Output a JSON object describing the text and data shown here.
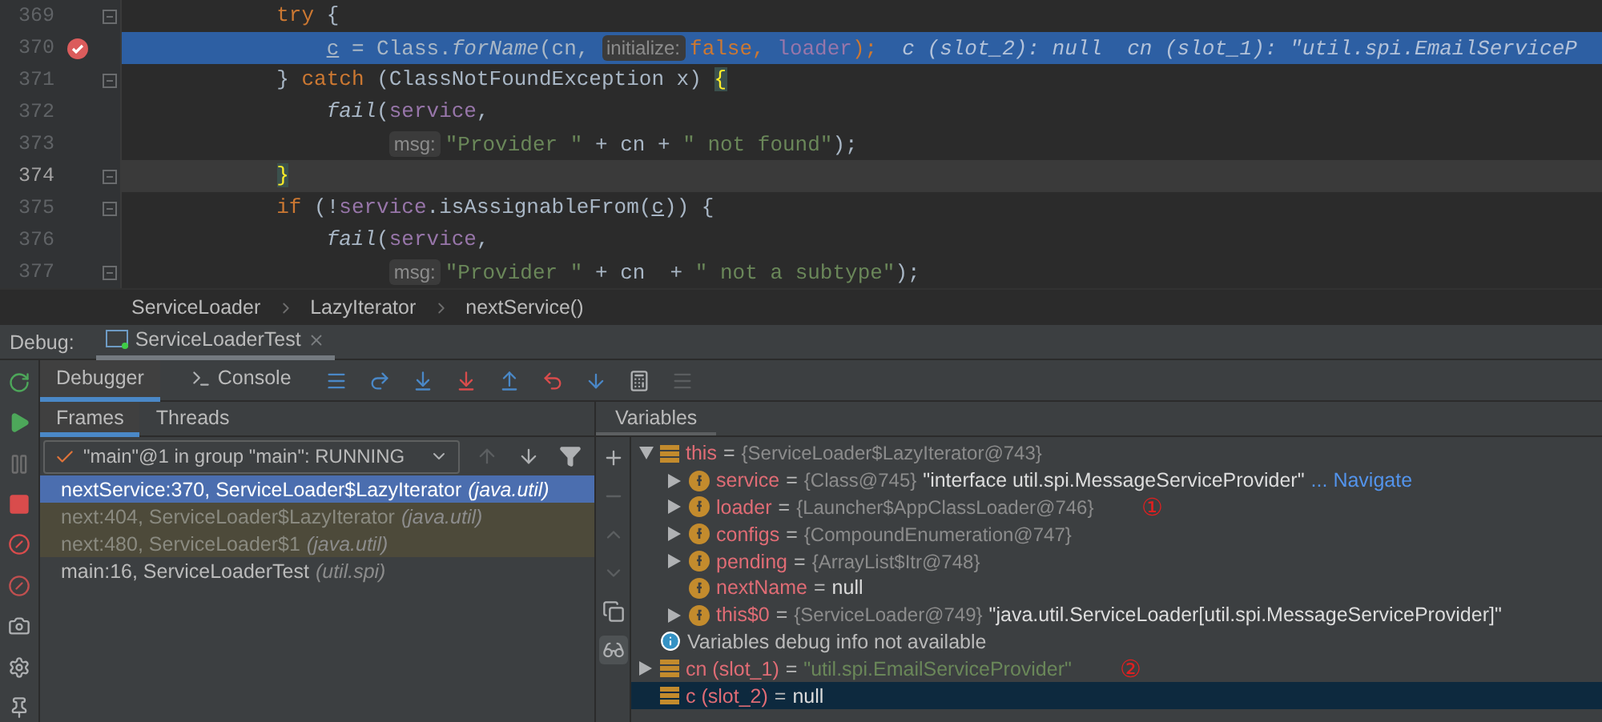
{
  "editor": {
    "lines": [
      {
        "number": "369",
        "execution": false,
        "caret": false,
        "breakpoint": false,
        "fold": true,
        "tokens": [
          {
            "kind": "keyword",
            "text": "            try"
          },
          {
            "kind": "plain",
            "text": " {"
          }
        ]
      },
      {
        "number": "370",
        "execution": true,
        "caret": false,
        "breakpoint": true,
        "fold": false,
        "tokens": [
          {
            "kind": "var",
            "text": "                c"
          },
          {
            "kind": "plain",
            "text": " = Class."
          },
          {
            "kind": "method",
            "text": "forName"
          },
          {
            "kind": "plain",
            "text": "(cn, "
          },
          {
            "kind": "hint",
            "text": "initialize:"
          },
          {
            "kind": "keyword",
            "text": "false, "
          },
          {
            "kind": "field",
            "text": "loader"
          },
          {
            "kind": "keyword",
            "text": ");"
          },
          {
            "kind": "inline",
            "text": "  c (slot_2): null  cn (slot_1): \"util.spi.EmailServiceP"
          }
        ]
      },
      {
        "number": "371",
        "execution": false,
        "caret": false,
        "breakpoint": false,
        "fold": true,
        "tokens": [
          {
            "kind": "plain",
            "text": "            } "
          },
          {
            "kind": "keyword",
            "text": "catch"
          },
          {
            "kind": "plain",
            "text": " (ClassNotFoundException x) "
          },
          {
            "kind": "brace",
            "text": "{"
          }
        ]
      },
      {
        "number": "372",
        "execution": false,
        "caret": false,
        "breakpoint": false,
        "fold": false,
        "tokens": [
          {
            "kind": "method",
            "text": "                fail"
          },
          {
            "kind": "plain",
            "text": "("
          },
          {
            "kind": "field",
            "text": "service"
          },
          {
            "kind": "plain",
            "text": ","
          }
        ]
      },
      {
        "number": "373",
        "execution": false,
        "caret": false,
        "breakpoint": false,
        "fold": false,
        "tokens": [
          {
            "kind": "hint",
            "text": "                     msg:"
          },
          {
            "kind": "string",
            "text": "\"Provider \""
          },
          {
            "kind": "plain",
            "text": " + cn + "
          },
          {
            "kind": "string",
            "text": "\" not found\""
          },
          {
            "kind": "plain",
            "text": ");"
          }
        ]
      },
      {
        "number": "374",
        "execution": false,
        "caret": true,
        "breakpoint": false,
        "fold": true,
        "tokens": [
          {
            "kind": "brace",
            "text": "            }"
          }
        ]
      },
      {
        "number": "375",
        "execution": false,
        "caret": false,
        "breakpoint": false,
        "fold": true,
        "tokens": [
          {
            "kind": "keyword",
            "text": "            if"
          },
          {
            "kind": "plain",
            "text": " (!"
          },
          {
            "kind": "field",
            "text": "service"
          },
          {
            "kind": "plain",
            "text": ".isAssignableFrom("
          },
          {
            "kind": "var",
            "text": "c"
          },
          {
            "kind": "plain",
            "text": ")) {"
          }
        ]
      },
      {
        "number": "376",
        "execution": false,
        "caret": false,
        "breakpoint": false,
        "fold": false,
        "tokens": [
          {
            "kind": "method",
            "text": "                fail"
          },
          {
            "kind": "plain",
            "text": "("
          },
          {
            "kind": "field",
            "text": "service"
          },
          {
            "kind": "plain",
            "text": ","
          }
        ]
      },
      {
        "number": "377",
        "execution": false,
        "caret": false,
        "breakpoint": false,
        "fold": true,
        "tokens": [
          {
            "kind": "hint",
            "text": "                     msg:"
          },
          {
            "kind": "string",
            "text": "\"Provider \""
          },
          {
            "kind": "plain",
            "text": " + cn  + "
          },
          {
            "kind": "string",
            "text": "\" not a subtype\""
          },
          {
            "kind": "plain",
            "text": ");"
          }
        ]
      }
    ]
  },
  "breadcrumbs": [
    "ServiceLoader",
    "LazyIterator",
    "nextService()"
  ],
  "debug_bar": {
    "label": "Debug:",
    "session": "ServiceLoaderTest"
  },
  "tabs": [
    {
      "label": "Debugger",
      "selected": true
    },
    {
      "label": "Console",
      "selected": false
    }
  ],
  "frames_panel": {
    "tabs": [
      {
        "label": "Frames",
        "selected": true
      },
      {
        "label": "Threads",
        "selected": false
      }
    ],
    "thread": {
      "value": "\"main\"@1 in group \"main\": RUNNING"
    },
    "frames": [
      {
        "frame": "nextService:370, ServiceLoader$LazyIterator",
        "package": "(java.util)",
        "kind": "project",
        "selected": true
      },
      {
        "frame": "next:404, ServiceLoader$LazyIterator",
        "package": "(java.util)",
        "kind": "library",
        "selected": false
      },
      {
        "frame": "next:480, ServiceLoader$1",
        "package": "(java.util)",
        "kind": "library",
        "selected": false
      },
      {
        "frame": "main:16, ServiceLoaderTest",
        "package": "(util.spi)",
        "kind": "project",
        "selected": false
      }
    ]
  },
  "variables": {
    "title": "Variables",
    "items": [
      {
        "kind": "object",
        "expandable": true,
        "expanded": true,
        "name": "this",
        "sep": "=",
        "ref": "{ServiceLoader$LazyIterator@743}",
        "selected": false,
        "children": [
          {
            "kind": "field",
            "expandable": true,
            "expanded": false,
            "name": "service",
            "sep": "=",
            "ref": "{Class@745}",
            "value": "\"interface util.spi.MessageServiceProvider\"",
            "is_string": false,
            "link": "... Navigate",
            "selected": false
          },
          {
            "kind": "field",
            "expandable": true,
            "expanded": false,
            "name": "loader",
            "sep": "=",
            "ref": "{Launcher$AppClassLoader@746}",
            "callout": "①",
            "selected": false
          },
          {
            "kind": "field",
            "expandable": true,
            "expanded": false,
            "name": "configs",
            "sep": "=",
            "ref": "{CompoundEnumeration@747}",
            "selected": false
          },
          {
            "kind": "field",
            "expandable": true,
            "expanded": false,
            "name": "pending",
            "sep": "=",
            "ref": "{ArrayList$Itr@748}",
            "selected": false
          },
          {
            "kind": "field",
            "expandable": false,
            "expanded": false,
            "name": "nextName",
            "sep": "=",
            "value": "null",
            "is_string": false,
            "selected": false
          },
          {
            "kind": "field",
            "expandable": true,
            "expanded": false,
            "name": "this$0",
            "sep": "=",
            "ref": "{ServiceLoader@749}",
            "value": "\"java.util.ServiceLoader[util.spi.MessageServiceProvider]\"",
            "is_string": false,
            "selected": false
          }
        ]
      },
      {
        "kind": "info",
        "expandable": false,
        "expanded": false,
        "name": "Variables debug info not available",
        "selected": false
      },
      {
        "kind": "local",
        "expandable": true,
        "expanded": false,
        "name": "cn (slot_1)",
        "sep": "=",
        "value": "\"util.spi.EmailServiceProvider\"",
        "is_string": true,
        "callout": "②",
        "selected": false
      },
      {
        "kind": "local",
        "expandable": false,
        "expanded": false,
        "name": "c (slot_2)",
        "sep": "=",
        "value": "null",
        "is_string": false,
        "selected": true
      }
    ]
  }
}
